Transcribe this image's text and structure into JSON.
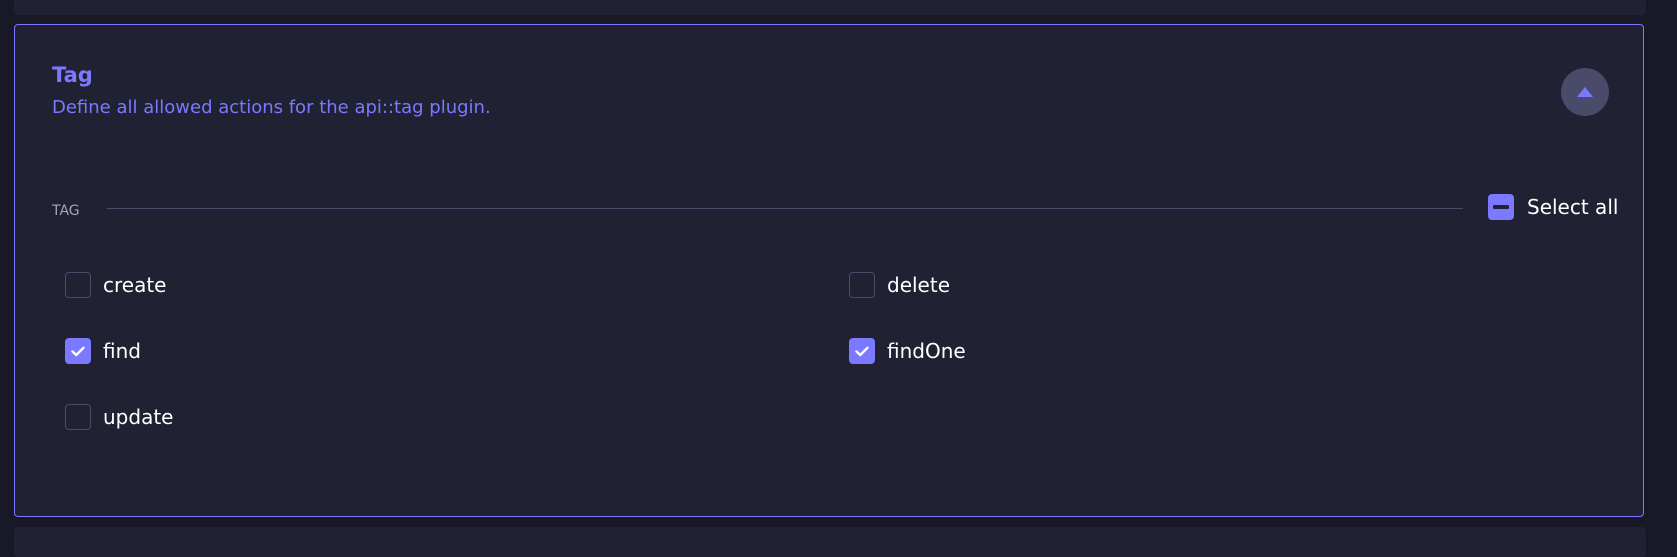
{
  "panel": {
    "title": "Tag",
    "subtitle": "Define all allowed actions for the api::tag plugin.",
    "border_color": "#7b79ff",
    "background": "#212134",
    "collapse_icon": "caret-up-icon",
    "expanded": true
  },
  "section": {
    "label": "TAG",
    "select_all": {
      "label": "Select all",
      "state": "indeterminate",
      "icon": "minus-icon"
    }
  },
  "actions": [
    {
      "label": "create",
      "checked": false
    },
    {
      "label": "delete",
      "checked": false
    },
    {
      "label": "find",
      "checked": true
    },
    {
      "label": "findOne",
      "checked": true
    },
    {
      "label": "update",
      "checked": false
    }
  ],
  "colors": {
    "accent": "#7b79ff",
    "page_background": "#181826",
    "text": "#ffffff",
    "muted_text": "#a5a5ba",
    "divider": "#4a4a6a"
  }
}
